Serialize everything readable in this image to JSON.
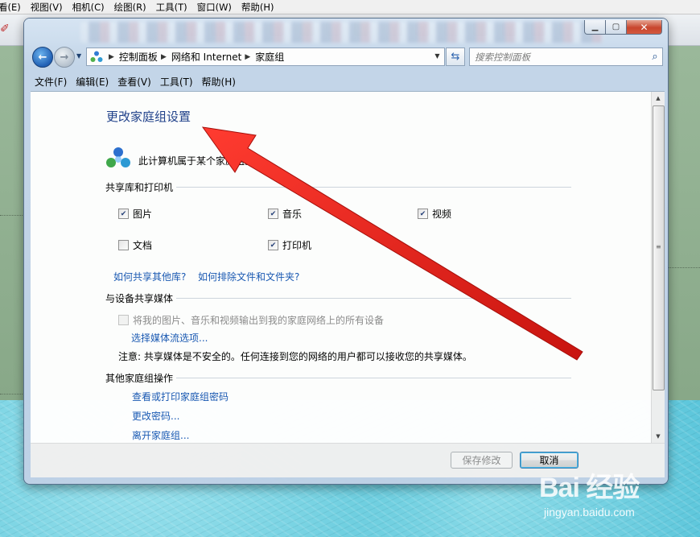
{
  "background_app": {
    "menu": [
      "看(E)",
      "视图(V)",
      "相机(C)",
      "绘图(R)",
      "工具(T)",
      "窗口(W)",
      "帮助(H)"
    ]
  },
  "window": {
    "address": {
      "crumbs": [
        "控制面板",
        "网络和 Internet",
        "家庭组"
      ]
    },
    "search": {
      "placeholder": "搜索控制面板"
    },
    "menu": [
      "文件(F)",
      "编辑(E)",
      "查看(V)",
      "工具(T)",
      "帮助(H)"
    ],
    "content": {
      "title": "更改家庭组设置",
      "membership_text": "此计算机属于某个家庭组。",
      "share_section": {
        "title": "共享库和打印机",
        "items": [
          {
            "label": "图片",
            "checked": true
          },
          {
            "label": "音乐",
            "checked": true
          },
          {
            "label": "视频",
            "checked": true
          },
          {
            "label": "文档",
            "checked": false
          },
          {
            "label": "打印机",
            "checked": true
          }
        ],
        "link1": "如何共享其他库?",
        "link2": "如何排除文件和文件夹?"
      },
      "media_section": {
        "title": "与设备共享媒体",
        "checkbox_label": "将我的图片、音乐和视频输出到我的家庭网络上的所有设备",
        "checkbox_checked": false,
        "link": "选择媒体流选项...",
        "note": "注意: 共享媒体是不安全的。任何连接到您的网络的用户都可以接收您的共享媒体。"
      },
      "other_section": {
        "title": "其他家庭组操作",
        "links": [
          "查看或打印家庭组密码",
          "更改密码...",
          "离开家庭组..."
        ]
      }
    },
    "buttons": {
      "save": "保存修改",
      "cancel": "取消"
    }
  },
  "watermark": {
    "logo": "Bai 经验",
    "url": "jingyan.baidu.com"
  },
  "colors": {
    "title_blue": "#1e3f8a",
    "link_blue": "#1858b3",
    "annotation_red": "#e0221a"
  }
}
